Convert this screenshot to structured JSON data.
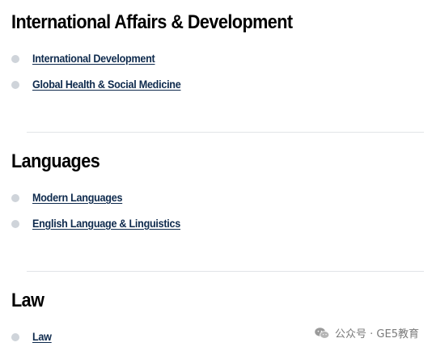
{
  "sections": [
    {
      "title": "International Affairs & Development",
      "links": [
        "International Development",
        "Global Health & Social Medicine"
      ]
    },
    {
      "title": "Languages",
      "links": [
        "Modern Languages",
        "English Language & Linguistics"
      ]
    },
    {
      "title": "Law",
      "links": [
        "Law"
      ]
    }
  ],
  "watermark": {
    "icon": "wechat-icon",
    "text": "公众号 · GE5教育"
  },
  "colors": {
    "heading": "#000000",
    "link": "#0e2a4d",
    "bullet": "#cfd4da",
    "divider": "#e1e4e8",
    "watermark": "#7a7a7a"
  }
}
